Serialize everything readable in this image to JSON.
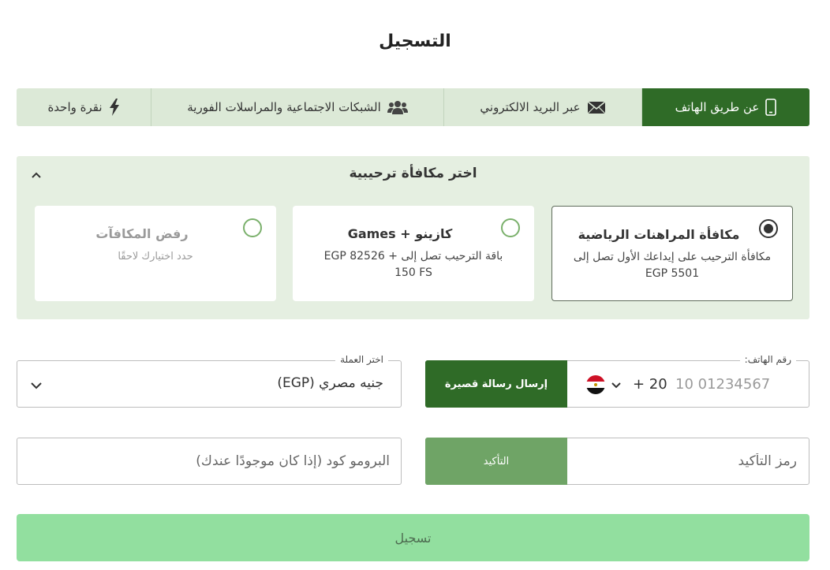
{
  "page": {
    "title": "التسجيل"
  },
  "tabs": [
    {
      "label": "عن طريق الهاتف",
      "icon": "phone-icon",
      "active": true
    },
    {
      "label": "عبر البريد الالكتروني",
      "icon": "envelope-icon",
      "active": false
    },
    {
      "label": "الشبكات الاجتماعية والمراسلات الفورية",
      "icon": "users-icon",
      "active": false
    },
    {
      "label": "نقرة واحدة",
      "icon": "lightning-icon",
      "active": false
    }
  ],
  "bonus": {
    "title": "اختر مكافأة ترحيبية",
    "options": [
      {
        "title": "مكافأة المراهنات الرياضية",
        "desc": "مكافأة الترحيب على إيداعك الأول تصل إلى EGP 5501",
        "selected": true
      },
      {
        "title": "كازينو + Games",
        "desc": "باقة الترحيب تصل إلى EGP 82526 + 150 FS",
        "selected": false
      },
      {
        "title": "رفض المكافآت",
        "desc": "حدد اختيارك لاحقًا",
        "selected": false
      }
    ]
  },
  "phone": {
    "legend": "رقم الهاتف:",
    "placeholder": "10 01234567",
    "code": "+ 20",
    "flag": "egypt-flag-icon",
    "send_button": "إرسال رسالة قصيرة"
  },
  "currency": {
    "legend": "اختر العملة",
    "value": "جنيه مصري (EGP)"
  },
  "confirm": {
    "placeholder": "رمز التأكيد",
    "button": "التأكيد"
  },
  "promo": {
    "placeholder": "البرومو كود (إذا كان موجودًا عندك)"
  },
  "submit": {
    "label": "تسجيل"
  },
  "colors": {
    "primary": "#2f6b27",
    "tab_bg": "#dce9d7",
    "panel_bg": "#e5efe1",
    "confirm_btn": "#6fa466",
    "submit_bg": "#92df9f"
  }
}
